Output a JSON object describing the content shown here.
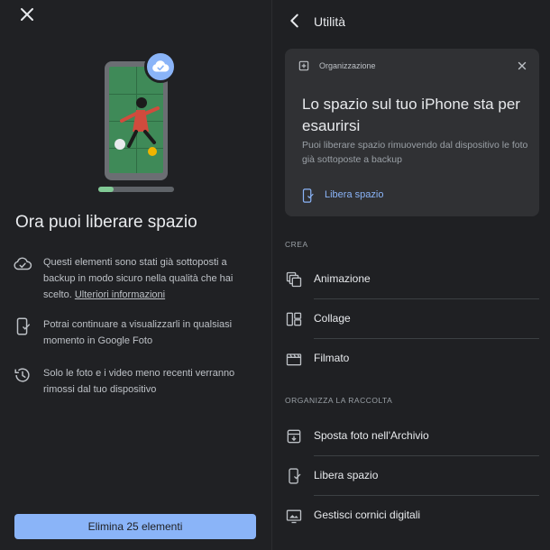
{
  "left": {
    "close_icon": "close-icon",
    "badge_icon": "cloud-check-icon",
    "backup_progress": 0.2,
    "headline": "Ora puoi liberare spazio",
    "info": [
      {
        "icon": "cloud-done-icon",
        "text": "Questi elementi sono stati già sottoposti a backup in modo sicuro nella qualità che hai scelto.",
        "link": "Ulteriori informazioni"
      },
      {
        "icon": "phone-check-icon",
        "text": "Potrai continuare a visualizzarli in qualsiasi momento in Google Foto"
      },
      {
        "icon": "history-icon",
        "text": "Solo le foto e i video meno recenti verranno rimossi dal tuo dispositivo"
      }
    ],
    "primary_button": "Elimina 25 elementi"
  },
  "right": {
    "title": "Utilità",
    "card": {
      "tag": "Organizzazione",
      "title": "Lo spazio sul tuo iPhone sta per esaurirsi",
      "body": "Puoi liberare spazio rimuovendo dal dispositivo le foto già sottoposte a backup",
      "link": "Libera spazio"
    },
    "sections": [
      {
        "label": "CREA",
        "items": [
          "Animazione",
          "Collage",
          "Filmato"
        ]
      },
      {
        "label": "ORGANIZZA LA RACCOLTA",
        "items": [
          "Sposta foto nell'Archivio",
          "Libera spazio",
          "Gestisci cornici digitali"
        ]
      }
    ]
  },
  "colors": {
    "background": "#202124",
    "card": "#303134",
    "accent": "#8ab4f8",
    "progress": "#81c995"
  }
}
